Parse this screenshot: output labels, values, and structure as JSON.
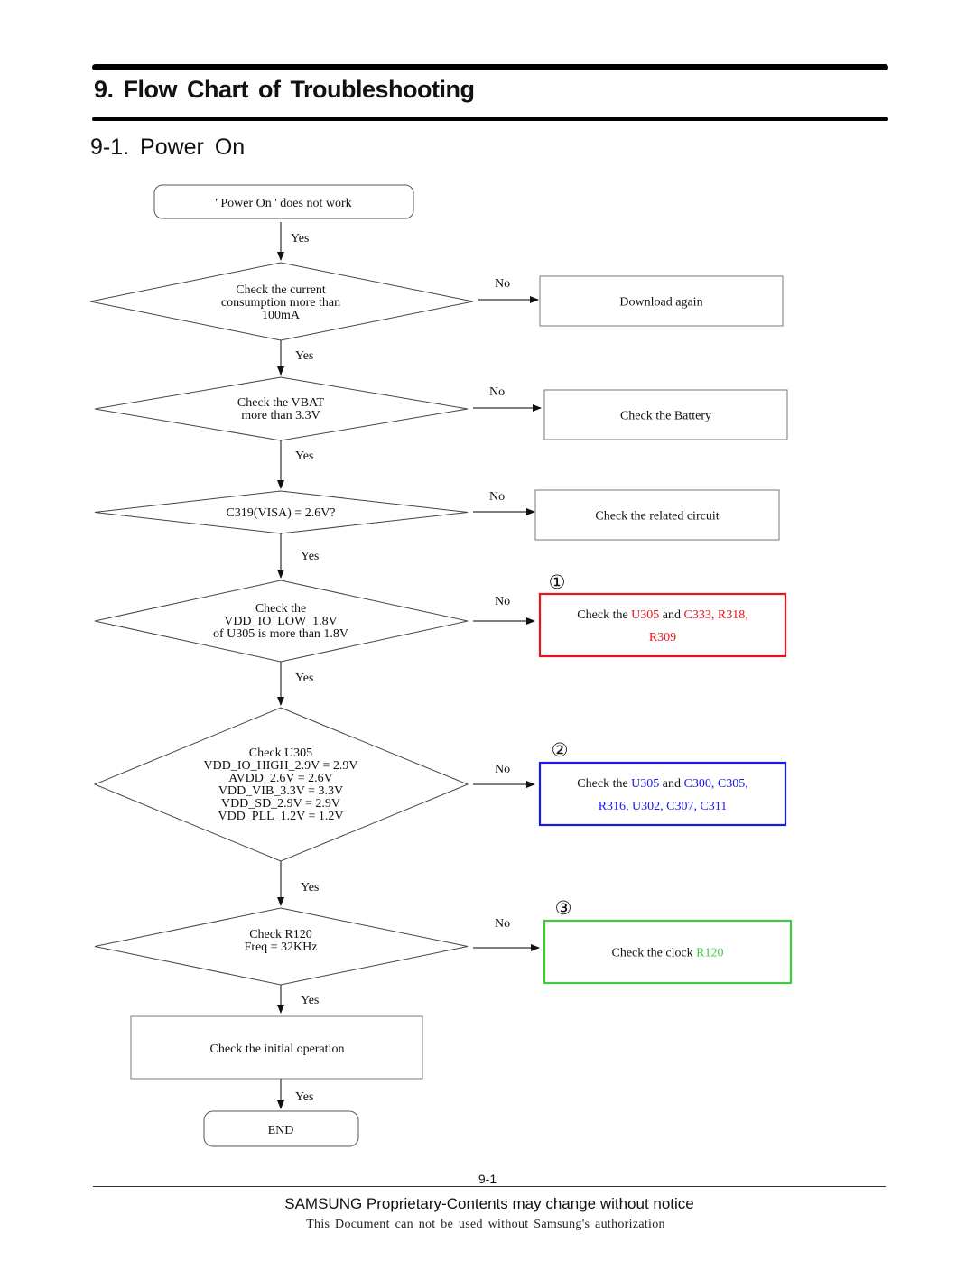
{
  "header": {
    "title": "9.  Flow  Chart  of  Troubleshooting",
    "section": "9-1.  Power  On"
  },
  "colors": {
    "red": "#e8141c",
    "blue": "#1a1aee",
    "green": "#3dcc3d",
    "line": "#333333"
  },
  "flow": {
    "start": "' Power On ' does not work",
    "yes": "Yes",
    "no": "No",
    "decisions": [
      {
        "lines": [
          "Check the current",
          "consumption more than",
          "100mA"
        ],
        "no_action": [
          "Download again"
        ]
      },
      {
        "lines": [
          "Check the VBAT",
          "more than 3.3V"
        ],
        "no_action": [
          "Check the Battery"
        ]
      },
      {
        "lines": [
          "C319(VISA) = 2.6V?"
        ],
        "no_action": [
          "Check the related circuit"
        ]
      },
      {
        "lines": [
          "Check the",
          "VDD_IO_LOW_1.8V",
          "of U305 is more than 1.8V"
        ],
        "marker": "①",
        "no_action_parts": [
          [
            {
              "t": "Check the ",
              "c": "black"
            },
            {
              "t": "U305",
              "c": "red"
            },
            {
              "t": " and ",
              "c": "black"
            },
            {
              "t": "C333, R318,",
              "c": "red"
            }
          ],
          [
            {
              "t": "R309",
              "c": "red"
            }
          ]
        ]
      },
      {
        "lines": [
          "Check U305",
          "VDD_IO_HIGH_2.9V = 2.9V",
          "AVDD_2.6V = 2.6V",
          "VDD_VIB_3.3V = 3.3V",
          "VDD_SD_2.9V = 2.9V",
          "VDD_PLL_1.2V = 1.2V"
        ],
        "marker": "②",
        "no_action_parts": [
          [
            {
              "t": "Check the ",
              "c": "black"
            },
            {
              "t": "U305",
              "c": "blue"
            },
            {
              "t": " and ",
              "c": "black"
            },
            {
              "t": "C300, C305,",
              "c": "blue"
            }
          ],
          [
            {
              "t": "R316, U302, C307, C311",
              "c": "blue"
            }
          ]
        ]
      },
      {
        "lines": [
          "Check R120",
          "Freq = 32KHz"
        ],
        "marker": "③",
        "no_action_parts": [
          [
            {
              "t": "Check the clock ",
              "c": "black"
            },
            {
              "t": "R120",
              "c": "green"
            }
          ]
        ]
      }
    ],
    "final": "Check the initial operation",
    "end": "END"
  },
  "footer": {
    "page": "9-1",
    "notice": "SAMSUNG Proprietary-Contents may change without notice",
    "auth": "This Document can not be used without Samsung's authorization"
  }
}
